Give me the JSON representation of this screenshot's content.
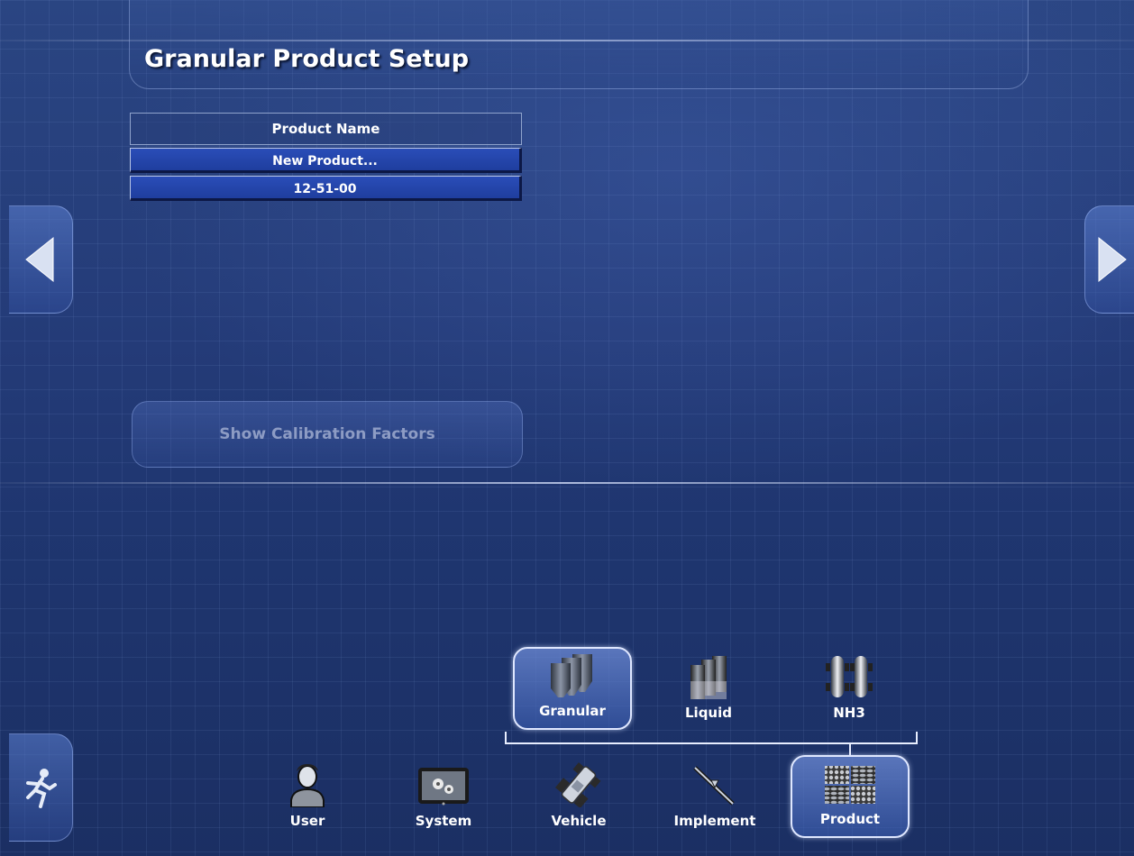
{
  "header": {
    "title": "Granular Product Setup"
  },
  "product_table": {
    "column_header": "Product Name",
    "rows": [
      "New Product...",
      "12-51-00"
    ]
  },
  "calibration_button": {
    "label": "Show Calibration Factors"
  },
  "sub_nav": {
    "items": [
      {
        "label": "Granular",
        "icon": "granular-bins-icon",
        "selected": true
      },
      {
        "label": "Liquid",
        "icon": "liquid-tanks-icon",
        "selected": false
      },
      {
        "label": "NH3",
        "icon": "nh3-tanks-icon",
        "selected": false
      }
    ]
  },
  "main_nav": {
    "items": [
      {
        "label": "User",
        "icon": "user-icon",
        "selected": false
      },
      {
        "label": "System",
        "icon": "system-gears-icon",
        "selected": false
      },
      {
        "label": "Vehicle",
        "icon": "vehicle-icon",
        "selected": false
      },
      {
        "label": "Implement",
        "icon": "implement-icon",
        "selected": false
      },
      {
        "label": "Product",
        "icon": "product-icon",
        "selected": true
      }
    ]
  },
  "colors": {
    "background": "#243b78",
    "row_fill": "#2a4db8",
    "text": "#ffffff",
    "disabled_text": "#8d9cc4"
  }
}
